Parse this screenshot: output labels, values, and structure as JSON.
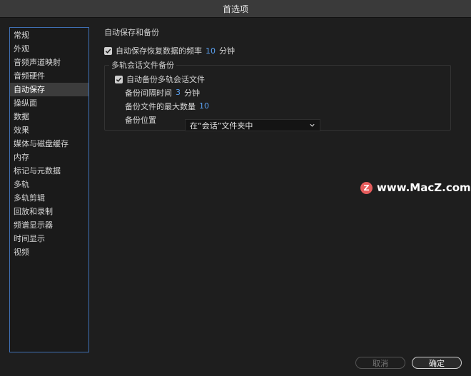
{
  "window": {
    "title": "首选项"
  },
  "sidebar": {
    "items": [
      {
        "label": "常规"
      },
      {
        "label": "外观"
      },
      {
        "label": "音频声道映射"
      },
      {
        "label": "音频硬件"
      },
      {
        "label": "自动保存",
        "selected": true
      },
      {
        "label": "操纵面"
      },
      {
        "label": "数据"
      },
      {
        "label": "效果"
      },
      {
        "label": "媒体与磁盘缓存"
      },
      {
        "label": "内存"
      },
      {
        "label": "标记与元数据"
      },
      {
        "label": "多轨"
      },
      {
        "label": "多轨剪辑"
      },
      {
        "label": "回放和录制"
      },
      {
        "label": "频谱显示器"
      },
      {
        "label": "时间显示"
      },
      {
        "label": "视频"
      }
    ]
  },
  "main": {
    "section_title": "自动保存和备份",
    "autosave": {
      "checked": true,
      "label": "自动保存恢复数据的频率",
      "value": "10",
      "unit": "分钟"
    },
    "group": {
      "legend": "多轨会话文件备份",
      "backup": {
        "checked": true,
        "label": "自动备份多轨会话文件"
      },
      "interval": {
        "label": "备份间隔时间",
        "value": "3",
        "unit": "分钟"
      },
      "max_files": {
        "label": "备份文件的最大数量",
        "value": "10"
      },
      "location": {
        "label": "备份位置",
        "selected": "在“会话”文件夹中"
      }
    }
  },
  "watermark": {
    "icon_letter": "Z",
    "text": "www.MacZ.com"
  },
  "footer": {
    "cancel_label": "取消",
    "ok_label": "确定"
  },
  "colors": {
    "accent_value": "#5aa0f0",
    "selection_border": "#3f6fb3",
    "background": "#1e1e1e"
  }
}
